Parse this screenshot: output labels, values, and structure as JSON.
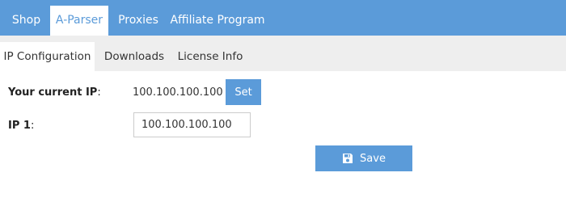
{
  "top_tabs": [
    "Shop",
    "A-Parser",
    "Proxies",
    "Affiliate Program"
  ],
  "top_active": "A-Parser",
  "sub_tabs": [
    "IP Configuration",
    "Downloads",
    "License Info"
  ],
  "sub_active": "IP Configuration",
  "form": {
    "current_ip_label": "Your current IP",
    "label_suffix": ":",
    "current_ip_value": "100.100.100.100",
    "set_label": "Set",
    "ip1_label": "IP 1",
    "ip1_value": "100.100.100.100",
    "save_label": "Save"
  },
  "icons": {
    "save": "save-icon"
  },
  "colors": {
    "accent": "#5b9bd9",
    "subnav_bg": "#eeeeee"
  }
}
